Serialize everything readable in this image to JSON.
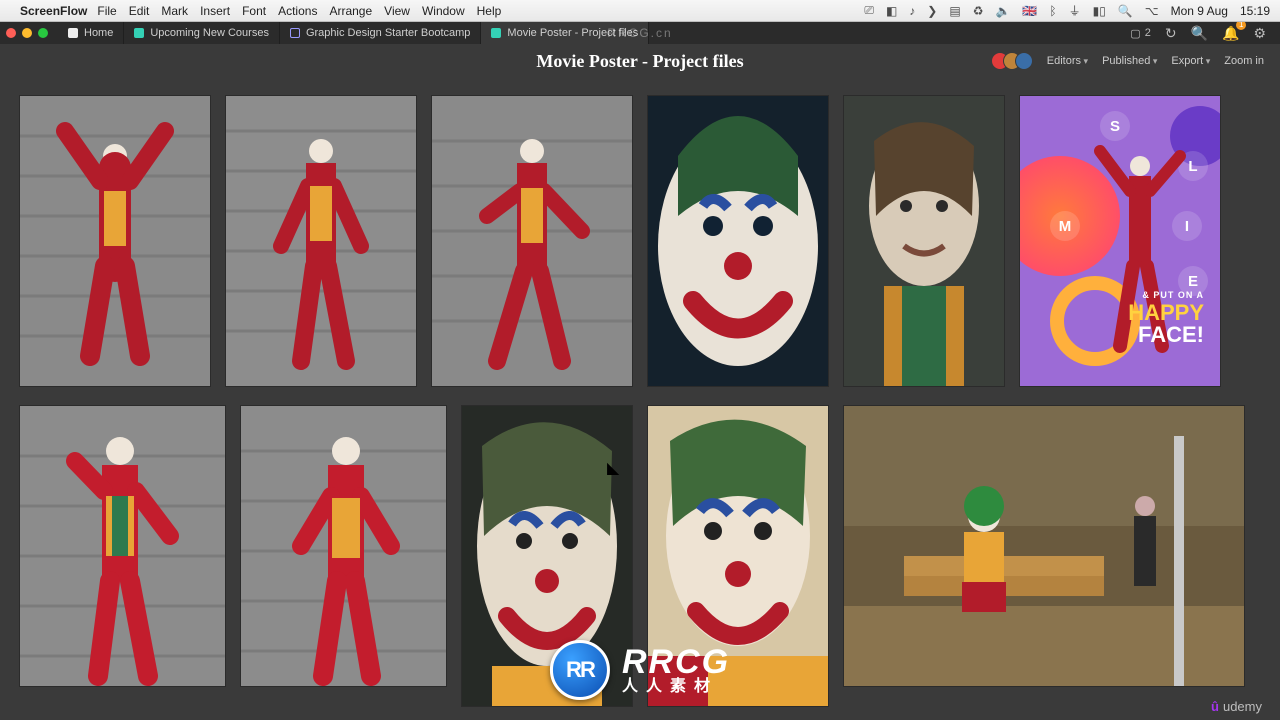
{
  "menubar": {
    "app": "ScreenFlow",
    "items": [
      "File",
      "Edit",
      "Mark",
      "Insert",
      "Font",
      "Actions",
      "Arrange",
      "View",
      "Window",
      "Help"
    ],
    "date": "Mon 9 Aug",
    "time": "15:19",
    "device_count": "2"
  },
  "tabs": {
    "home": "Home",
    "t1": "Upcoming New Courses",
    "t2": "Graphic Design Starter Bootcamp",
    "t3": "Movie Poster - Project files"
  },
  "title": "Movie Poster - Project files",
  "actions": {
    "editors": "Editors",
    "published": "Published",
    "export": "Export",
    "zoom": "Zoom in"
  },
  "poster": {
    "l_s": "S",
    "l_l": "L",
    "l_m": "M",
    "l_i": "I",
    "l_e": "E",
    "kicker": "& PUT ON A",
    "word1": "HAPPY",
    "word2": "FACE!"
  },
  "watermark": {
    "top": "RRCG.cn",
    "logo_letters": "RR",
    "big": "RRCG",
    "sub": "人人素材"
  },
  "udemy": "udemy",
  "notif_badge": "1"
}
